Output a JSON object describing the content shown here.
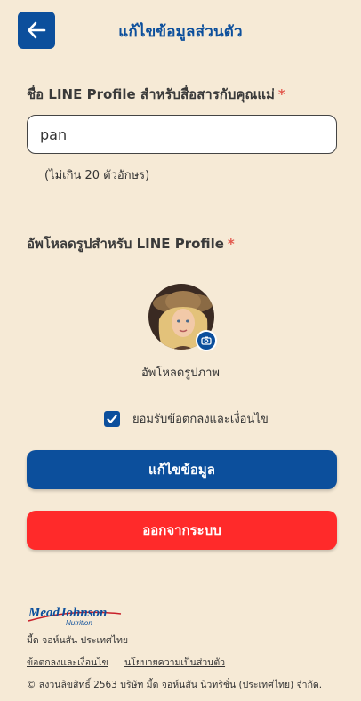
{
  "header": {
    "title": "แก้ไขข้อมูลส่วนตัว",
    "back_icon": "arrow-left-icon"
  },
  "form": {
    "name_label": "ชื่อ LINE Profile สำหรับสื่อสารกับคุณแม่",
    "required_mark": "*",
    "name_value": "pan",
    "name_hint": "(ไม่เกิน 20 ตัวอักษร)",
    "upload_label": "อัพโหลดรูปสำหรับ LINE Profile",
    "upload_caption": "อัพโหลดรูปภาพ",
    "camera_icon": "camera-icon",
    "consent_text": "ยอมรับข้อตกลงและเงื่อนไข",
    "consent_checked": true
  },
  "buttons": {
    "edit_label": "แก้ไขข้อมูล",
    "logout_label": "ออกจากระบบ"
  },
  "footer": {
    "logo_text_main": "MeadJohnson",
    "logo_text_sub": "Nutrition",
    "company_name": "มี้ด จอห์นสัน ประเทศไทย",
    "terms_link": "ข้อตกลงและเงื่อนไข",
    "privacy_link": "นโยบายความเป็นส่วนตัว",
    "copyright": "© สงวนลิขสิทธิ์ 2563 บริษัท มี้ด จอห์นสัน นิวทริชั่น (ประเทศไทย) จำกัด."
  },
  "colors": {
    "primary": "#0c4f9c",
    "danger": "#ff2a2a",
    "background": "#f6ead6",
    "required": "#e2574c"
  }
}
